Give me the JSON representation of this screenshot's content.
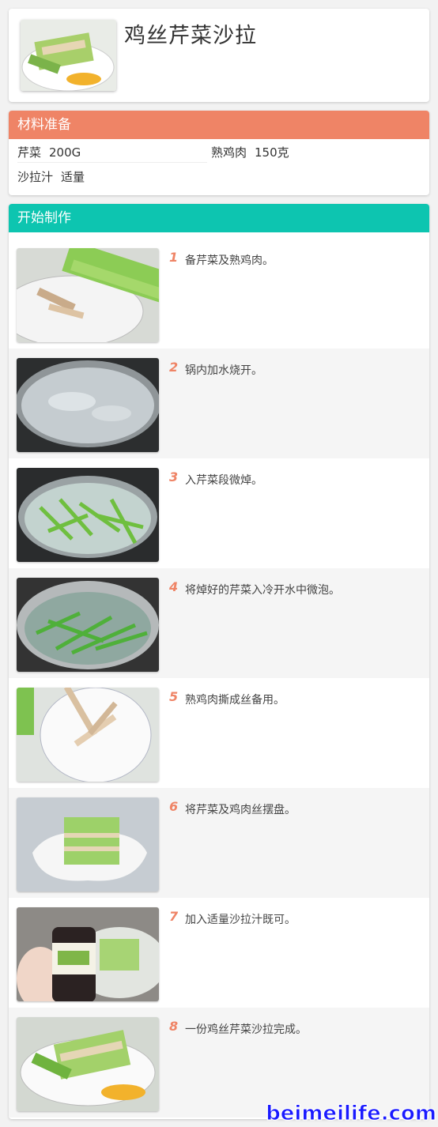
{
  "recipe": {
    "title": "鸡丝芹菜沙拉"
  },
  "ingredients": {
    "header": "材料准备",
    "items": [
      {
        "name": "芹菜",
        "amount": "200G"
      },
      {
        "name": "熟鸡肉",
        "amount": "150克"
      },
      {
        "name": "沙拉汁",
        "amount": "适量"
      }
    ]
  },
  "steps": {
    "header": "开始制作",
    "items": [
      {
        "num": "1",
        "text": "备芹菜及熟鸡肉。"
      },
      {
        "num": "2",
        "text": "锅内加水烧开。"
      },
      {
        "num": "3",
        "text": "入芹菜段微焯。"
      },
      {
        "num": "4",
        "text": "将焯好的芹菜入冷开水中微泡。"
      },
      {
        "num": "5",
        "text": "熟鸡肉撕成丝备用。"
      },
      {
        "num": "6",
        "text": "将芹菜及鸡肉丝摆盘。"
      },
      {
        "num": "7",
        "text": "加入适量沙拉汁既可。"
      },
      {
        "num": "8",
        "text": "一份鸡丝芹菜沙拉完成。"
      }
    ]
  },
  "watermark": "beimeilife.com",
  "colors": {
    "ingredients_header": "#ef8466",
    "steps_header": "#0dc5b0",
    "step_number": "#ef8466"
  }
}
